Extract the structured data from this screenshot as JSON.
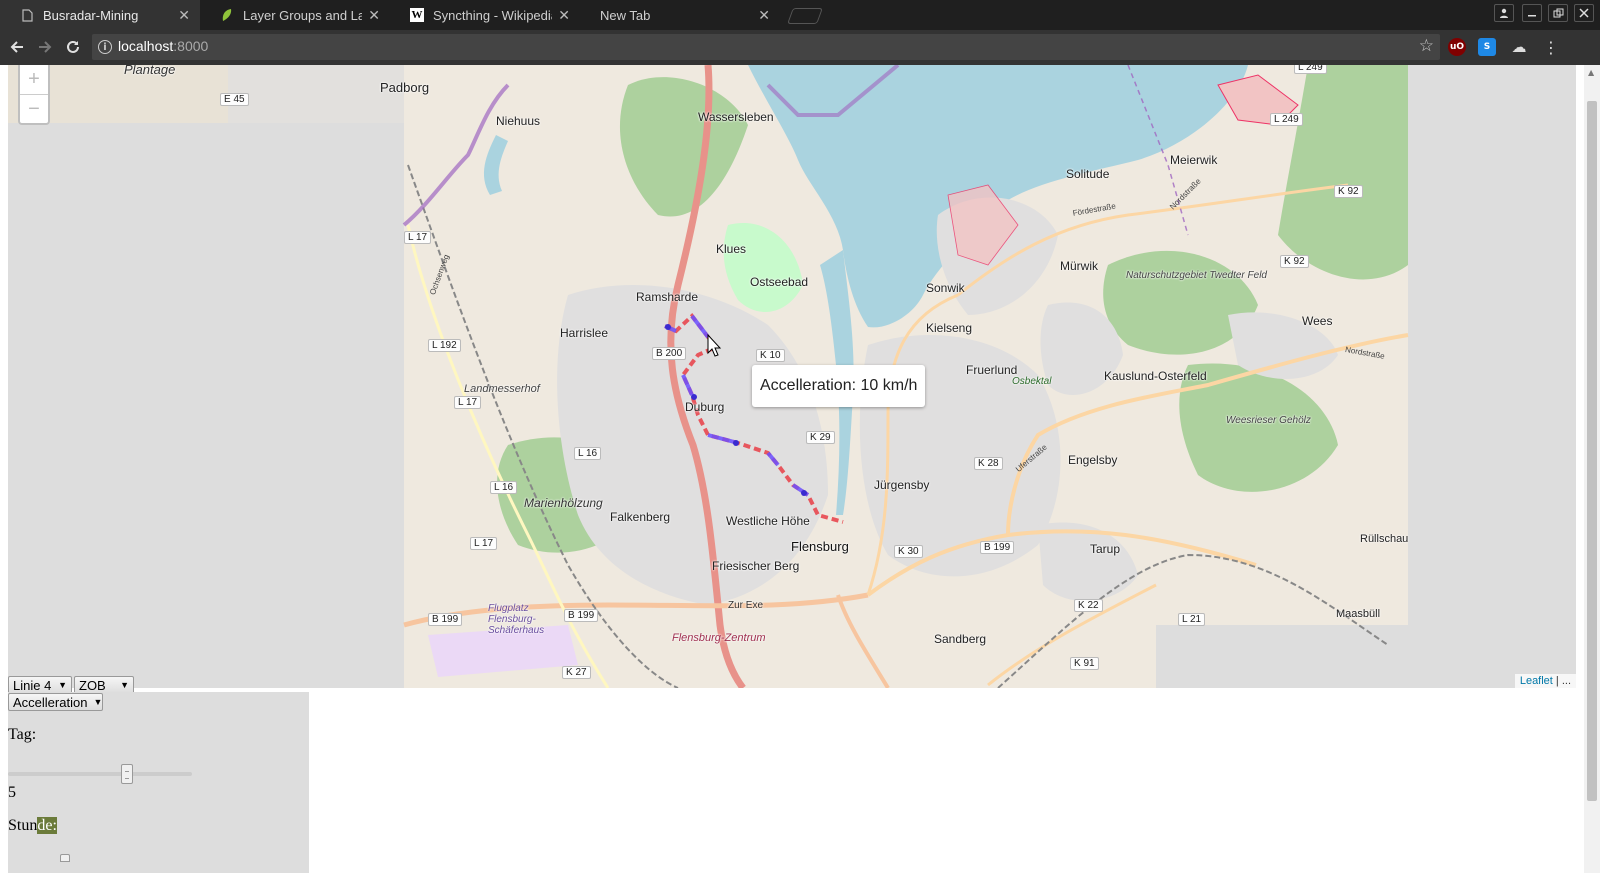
{
  "tabs": [
    {
      "title": "Busradar-Mining",
      "icon": "page-icon",
      "active": true
    },
    {
      "title": "Layer Groups and Layer",
      "icon": "leaflet-icon",
      "active": false
    },
    {
      "title": "Syncthing - Wikipedia",
      "icon": "wikipedia-icon",
      "active": false
    },
    {
      "title": "New Tab",
      "icon": "none",
      "active": false
    }
  ],
  "toolbar": {
    "url_host": "localhost",
    "url_port": ":8000"
  },
  "extensions": [
    {
      "name": "ublock-icon",
      "label": "uO",
      "color": "#800000"
    },
    {
      "name": "s-extension-icon",
      "label": "S",
      "color": "#1e88e5"
    },
    {
      "name": "cloud-sync-icon",
      "label": "☁",
      "color": "#555555"
    }
  ],
  "map": {
    "zoom_in": "+",
    "zoom_out": "−",
    "attribution_link": "Leaflet",
    "attribution_rest": " | ...",
    "tooltip": "Accelleration: 10 km/h",
    "place_labels": [
      "Plantage",
      "Padborg",
      "Niehuus",
      "Wassersleben",
      "Klues",
      "Ostseebad",
      "Ramsharde",
      "Harrislee",
      "Landmesserhof",
      "Duburg",
      "Marienhölzung",
      "Falkenberg",
      "Westliche Höhe",
      "Flensburg",
      "Friesischer Berg",
      "Flensburg-Zentrum",
      "Flugplatz Flensburg-Schäferhaus",
      "Sandberg",
      "Jürgensby",
      "Engelsby",
      "Tarup",
      "Fruerlund",
      "Kielseng",
      "Sonwik",
      "Mürwik",
      "Solitude",
      "Meierwik",
      "Wees",
      "Kauslund-Osterfeld",
      "Naturschutzgebiet Twedter Feld",
      "Weesrieser Gehölz",
      "Maasbüll",
      "Rüllschau",
      "Osbektal",
      "Zur Exe"
    ],
    "road_labels": [
      "E 45",
      "L 17",
      "L 192",
      "L 17",
      "B 200",
      "K 10",
      "L 16",
      "L 16",
      "L 17",
      "K 29",
      "K 28",
      "K 30",
      "B 199",
      "B 199",
      "B 199",
      "K 22",
      "L 21",
      "K 91",
      "K 27",
      "L 249",
      "L 249",
      "K 92",
      "K 92",
      "Ochsenweg",
      "Fördestraße",
      "Nordstraße",
      "Uferstraße",
      "Nordstraße"
    ],
    "route_colors": {
      "primary": "#e8474f",
      "accent": "#6a4fff"
    }
  },
  "controls": {
    "line_select": "Linie 4",
    "stop_select": "ZOB",
    "metric_select": "Accelleration",
    "day_label": "Tag:",
    "day_value": "5",
    "hour_label_a": "Stun",
    "hour_label_b": "de:"
  }
}
